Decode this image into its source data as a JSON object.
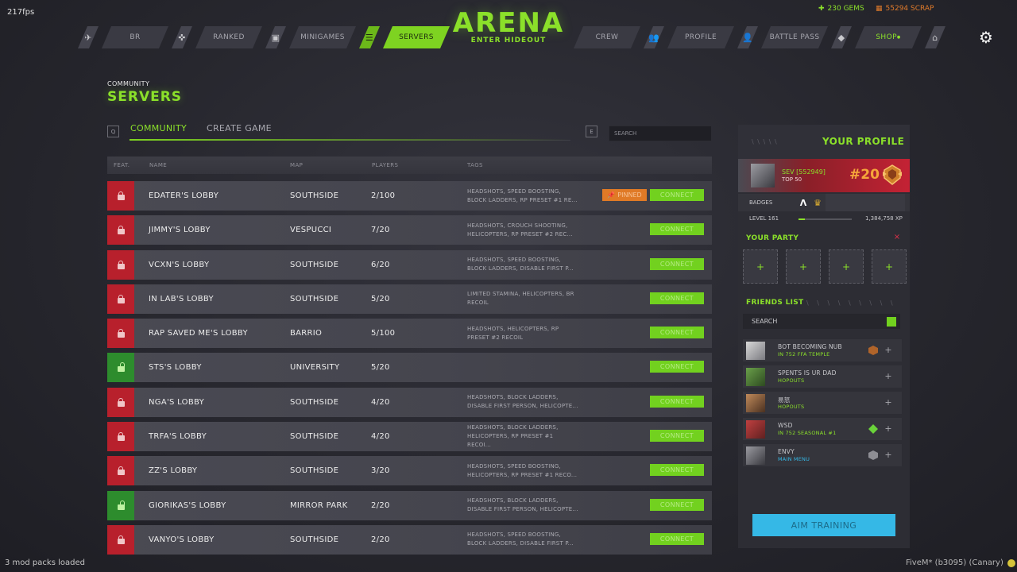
{
  "fps": "217fps",
  "nav": {
    "left": [
      {
        "icon": "✈",
        "icon_name": "plane-icon",
        "label": "BR"
      },
      {
        "icon": "✜",
        "icon_name": "crosshair-icon",
        "label": "RANKED"
      },
      {
        "icon": "▣",
        "icon_name": "gamepad-icon",
        "label": "MINIGAMES"
      },
      {
        "icon": "☰",
        "icon_name": "server-icon",
        "label": "SERVERS",
        "active": true
      }
    ],
    "right": [
      {
        "label": "CREW",
        "icon": "👥",
        "icon_name": "crew-icon"
      },
      {
        "label": "PROFILE",
        "icon": "👤",
        "icon_name": "profile-icon"
      },
      {
        "label": "BATTLE PASS",
        "icon": "◆",
        "icon_name": "ticket-icon"
      },
      {
        "label": "SHOP",
        "badge": "●",
        "icon": "⌂",
        "icon_name": "store-icon"
      }
    ]
  },
  "logo": {
    "title": "ARENA",
    "subtitle": "ENTER HIDEOUT"
  },
  "currency": {
    "gems": "230 GEMS",
    "scrap": "55294 SCRAP",
    "gems_color": "#8be02a",
    "scrap_color": "#e07a2a"
  },
  "page": {
    "subtitle": "COMMUNITY",
    "title": "SERVERS"
  },
  "tabs": {
    "left_key": "Q",
    "right_key": "E",
    "community": "COMMUNITY",
    "create": "CREATE GAME"
  },
  "search": {
    "placeholder": "SEARCH"
  },
  "table": {
    "headers": {
      "feat": "FEAT.",
      "name": "NAME",
      "map": "MAP",
      "players": "PLAYERS",
      "tags": "TAGS"
    },
    "connect_label": "CONNECT",
    "pinned_label": "PINNED",
    "rows": [
      {
        "locked": true,
        "name": "EDATER'S LOBBY",
        "map": "SOUTHSIDE",
        "players": "2/100",
        "tags": "HEADSHOTS, SPEED BOOSTING, BLOCK LADDERS, RP PRESET #1 RE...",
        "pinned": true
      },
      {
        "locked": true,
        "name": "JIMMY'S LOBBY",
        "map": "VESPUCCI",
        "players": "7/20",
        "tags": "HEADSHOTS, CROUCH SHOOTING, HELICOPTERS, RP PRESET #2 REC..."
      },
      {
        "locked": true,
        "name": "VCXN'S LOBBY",
        "map": "SOUTHSIDE",
        "players": "6/20",
        "tags": "HEADSHOTS, SPEED BOOSTING, BLOCK LADDERS, DISABLE FIRST P..."
      },
      {
        "locked": true,
        "name": "IN LAB'S LOBBY",
        "map": "SOUTHSIDE",
        "players": "5/20",
        "tags": "LIMITED STAMINA, HELICOPTERS, BR RECOIL"
      },
      {
        "locked": true,
        "name": "RAP SAVED ME'S LOBBY",
        "map": "BARRIO",
        "players": "5/100",
        "tags": "HEADSHOTS, HELICOPTERS, RP PRESET #2 RECOIL"
      },
      {
        "locked": false,
        "name": "STS'S LOBBY",
        "map": "UNIVERSITY",
        "players": "5/20",
        "tags": ""
      },
      {
        "locked": true,
        "name": "NGA'S LOBBY",
        "map": "SOUTHSIDE",
        "players": "4/20",
        "tags": "HEADSHOTS, BLOCK LADDERS, DISABLE FIRST PERSON, HELICOPTE..."
      },
      {
        "locked": true,
        "name": "TRFA'S LOBBY",
        "map": "SOUTHSIDE",
        "players": "4/20",
        "tags": "HEADSHOTS, BLOCK LADDERS, HELICOPTERS, RP PRESET #1 RECOI..."
      },
      {
        "locked": true,
        "name": "ZZ'S LOBBY",
        "map": "SOUTHSIDE",
        "players": "3/20",
        "tags": "HEADSHOTS, SPEED BOOSTING, HELICOPTERS, RP PRESET #1 RECO..."
      },
      {
        "locked": false,
        "name": "GIORIKAS'S LOBBY",
        "map": "MIRROR PARK",
        "players": "2/20",
        "tags": "HEADSHOTS, BLOCK LADDERS, DISABLE FIRST PERSON, HELICOPTE..."
      },
      {
        "locked": true,
        "name": "VANYO'S LOBBY",
        "map": "SOUTHSIDE",
        "players": "2/20",
        "tags": "HEADSHOTS, SPEED BOOSTING, BLOCK LADDERS, DISABLE FIRST P..."
      }
    ]
  },
  "profile": {
    "title": "YOUR PROFILE",
    "dashes": "\\ \\ \\ \\ \\",
    "name": "SEV [552949]",
    "top": "TOP 50",
    "rank": "#20",
    "badges_label": "BADGES",
    "level": "LEVEL 161",
    "xp": "1,384,758 XP",
    "xp_progress": 0.12
  },
  "party": {
    "title": "YOUR PARTY",
    "close": "×",
    "slot_label": "+",
    "slots": 4
  },
  "friends": {
    "title": "FRIENDS LIST",
    "dashes": "\\ \\ \\ \\ \\ \\ \\ \\ \\",
    "search": "SEARCH",
    "add": "+",
    "items": [
      {
        "name": "BOT BECOMING NUB",
        "status": "IN 752 FFA TEMPLE",
        "status_color": "#8be02a",
        "rank": "orange"
      },
      {
        "name": "SPENTS IS UR DAD",
        "status": "HOPOUTS",
        "status_color": "#8be02a"
      },
      {
        "name": "易怒",
        "status": "HOPOUTS",
        "status_color": "#8be02a"
      },
      {
        "name": "WSD",
        "status": "IN 752 SEASONAL #1",
        "status_color": "#8be02a",
        "rank": "green"
      },
      {
        "name": "ENVY",
        "status": "MAIN MENU",
        "status_color": "#35b8e6",
        "rank": "grey"
      }
    ]
  },
  "aim_training": "AIM TRAINING",
  "footer": {
    "left": "3 mod packs loaded",
    "right": "FiveM* (b3095) (Canary)"
  }
}
